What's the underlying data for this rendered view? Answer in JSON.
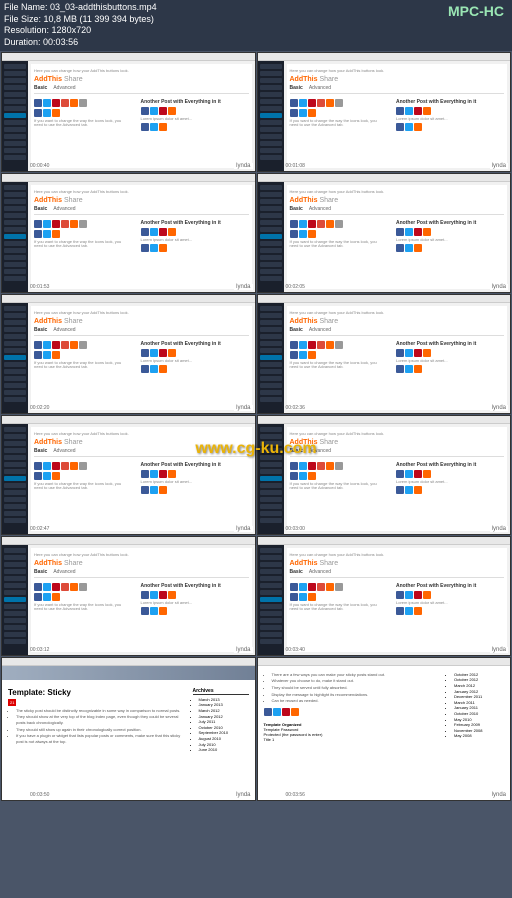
{
  "header": {
    "file_name_label": "File Name:",
    "file_name": "03_03-addthisbuttons.mp4",
    "file_size_label": "File Size:",
    "file_size": "10,8 MB (11 399 394 bytes)",
    "resolution_label": "Resolution:",
    "resolution": "1280x720",
    "duration_label": "Duration:",
    "duration": "00:03:56",
    "player": "MPC-HC"
  },
  "addthis": {
    "brand_orange": "AddThis",
    "brand_gray": "Share",
    "tab_basic": "Basic",
    "tab_advanced": "Advanced",
    "preview_title": "Another Post with Everything in it",
    "desc1": "Here you can change how your AddThis buttons look.",
    "desc2": "If you want to change the way the icons look, you need to use the Advanced tab."
  },
  "watermarks": {
    "lynda": "lynda",
    "cgku": "www.cg-ku.com"
  },
  "timestamps": [
    "00:00:40",
    "00:01:08",
    "00:01:53",
    "00:02:05",
    "00:02:20",
    "00:02:36",
    "00:02:47",
    "00:03:00",
    "00:03:12",
    "00:03:40",
    "00:03:50",
    "00:03:56"
  ],
  "blog": {
    "title_sticky": "Template: Sticky",
    "date": "21",
    "bullets": [
      "The sticky post should be distinctly recognizable in some way in comparison to normal posts.",
      "They should show at the very top of the blog index page, even though they could be several posts back chronologically.",
      "They should still show up again in their chronologically correct position.",
      "If you have a plugin or widget that lists popular posts or comments, make sure that this sticky post is not always at the top."
    ],
    "archives_title": "Archives",
    "archives": [
      "March 2013",
      "January 2013",
      "March 2012",
      "January 2012",
      "July 2011",
      "October 2010",
      "September 2010",
      "August 2010",
      "July 2010",
      "June 2010"
    ],
    "second_bullets": [
      "There are a few ways you can make your sticky posts stand out.",
      "Whatever you choose to do, make it stand out.",
      "They should be served until fully absorbed.",
      "Display the message to highlight its recommendations.",
      "Can be reused as needed."
    ],
    "tags_title": "Template Organized",
    "tags": [
      "Template Password",
      "Protected (the password is enter)",
      "Title 1"
    ],
    "months": [
      "October 2012",
      "October 2012",
      "March 2012",
      "January 2012",
      "December 2011",
      "March 2011",
      "January 2011",
      "October 2010",
      "May 2010",
      "February 2009",
      "November 2008",
      "May 2008"
    ]
  }
}
